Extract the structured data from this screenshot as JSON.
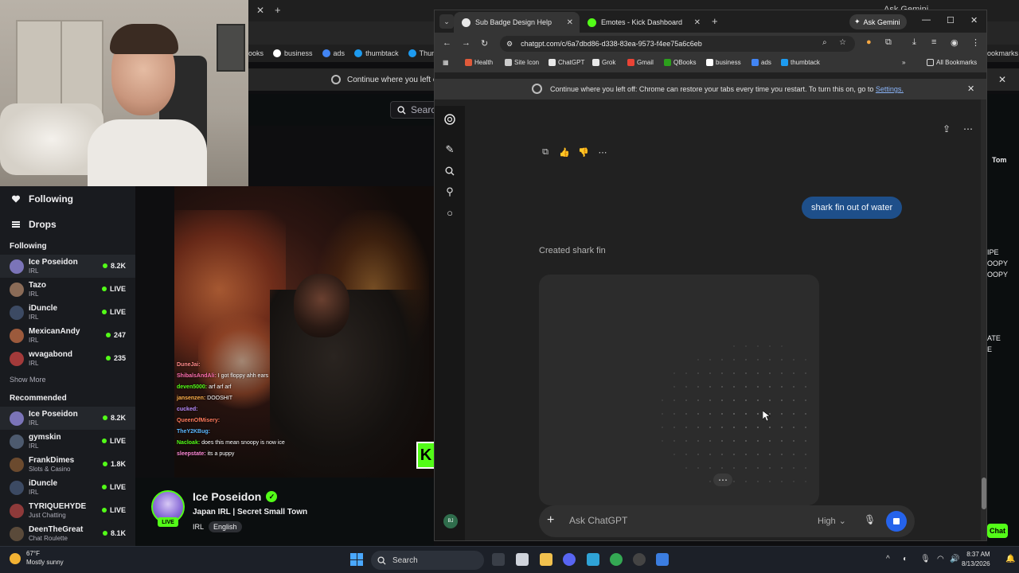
{
  "background_browser": {
    "bookmarks": [
      {
        "label": "ooks",
        "color": "#7a7a7a"
      },
      {
        "label": "business",
        "color": "#ffffff"
      },
      {
        "label": "ads",
        "color": "#4285f4"
      },
      {
        "label": "thumbtack",
        "color": "#1d9bf0"
      },
      {
        "label": "Thumbta",
        "color": "#1d9bf0"
      }
    ],
    "bookmarks_right": "ookmarks",
    "infobar_text": "Continue where you left off:",
    "gemini_label": "Ask Gemini",
    "search_label": "Searc"
  },
  "kick": {
    "sidebar": {
      "nav": [
        {
          "label": "Following",
          "icon": "heart-icon"
        },
        {
          "label": "Drops",
          "icon": "drops-icon"
        }
      ],
      "following_heading": "Following",
      "following": [
        {
          "name": "Ice Poseidon",
          "category": "IRL",
          "stat": "8.2K",
          "avatar": "#7b74b8",
          "active": true
        },
        {
          "name": "Tazo",
          "category": "IRL",
          "stat": "LIVE",
          "avatar": "#8a6b57"
        },
        {
          "name": "iDuncle",
          "category": "IRL",
          "stat": "LIVE",
          "avatar": "#3c4a63"
        },
        {
          "name": "MexicanAndy",
          "category": "IRL",
          "stat": "247",
          "avatar": "#9c5a3c"
        },
        {
          "name": "wvagabond",
          "category": "IRL",
          "stat": "235",
          "avatar": "#a33a3a"
        }
      ],
      "show_more": "Show More",
      "recommended_heading": "Recommended",
      "recommended": [
        {
          "name": "Ice Poseidon",
          "category": "IRL",
          "stat": "8.2K",
          "avatar": "#7b74b8",
          "active": true
        },
        {
          "name": "gymskin",
          "category": "IRL",
          "stat": "LIVE",
          "avatar": "#4d5a6e"
        },
        {
          "name": "FrankDimes",
          "category": "Slots & Casino",
          "stat": "1.8K",
          "avatar": "#6b4a2e"
        },
        {
          "name": "iDuncle",
          "category": "IRL",
          "stat": "LIVE",
          "avatar": "#3c4a63"
        },
        {
          "name": "TYRIQUEHYDE",
          "category": "Just Chatting",
          "stat": "LIVE",
          "avatar": "#8e3a3a"
        },
        {
          "name": "DeenTheGreat",
          "category": "Chat Roulette",
          "stat": "8.1K",
          "avatar": "#5a4a3a"
        }
      ]
    },
    "chat": [
      {
        "user": "DuneJai:",
        "text": "",
        "color": "#ff8a8a"
      },
      {
        "user": "ShibalsAndAli:",
        "text": "I got floppy ahh ears",
        "color": "#ff6fb0"
      },
      {
        "user": "deven5000:",
        "text": "arf arf arf",
        "color": "#53fc18"
      },
      {
        "user": "jansenzen:",
        "text": "DOOSHIT",
        "color": "#ffb14a"
      },
      {
        "user": "cucked:",
        "text": "",
        "color": "#b88cff"
      },
      {
        "user": "QueenOfMisery:",
        "text": "",
        "color": "#ff7a5c"
      },
      {
        "user": "TheY2KBug:",
        "text": "",
        "color": "#5cb8ff"
      },
      {
        "user": "Nacloak:",
        "text": "does this mean snoopy is now ice",
        "color": "#53fc18"
      },
      {
        "user": "sleepstate:",
        "text": "its a puppy",
        "color": "#ff8ad8"
      }
    ],
    "streamer": {
      "name": "Ice Poseidon",
      "live": "LIVE",
      "title": "Japan IRL | Secret Small Town",
      "category": "IRL",
      "language": "English"
    },
    "right_panel": {
      "tom": "Tom",
      "lines": [
        "IPE",
        "OOPY",
        "OOPY",
        "ATE",
        "E"
      ],
      "chat_btn": "Chat"
    }
  },
  "chrome": {
    "tabs": [
      {
        "label": "Sub Badge Design Help",
        "favicon": "#e8e8e8",
        "active": true
      },
      {
        "label": "Emotes - Kick Dashboard",
        "favicon": "#53fc18",
        "active": false
      }
    ],
    "gemini_label": "Ask Gemini",
    "url": "chatgpt.com/c/6a7dbd86-d338-83ea-9573-f4ee75a6c6eb",
    "bookmarks": [
      {
        "label": "Health",
        "color": "#e05a3a"
      },
      {
        "label": "Site Icon",
        "color": "#cccccc"
      },
      {
        "label": "ChatGPT",
        "color": "#e8e8e8"
      },
      {
        "label": "Grok",
        "color": "#e8e8e8"
      },
      {
        "label": "Gmail",
        "color": "#ea4335"
      },
      {
        "label": "QBooks",
        "color": "#2ca01c"
      },
      {
        "label": "business",
        "color": "#ffffff"
      },
      {
        "label": "ads",
        "color": "#4285f4"
      },
      {
        "label": "thumbtack",
        "color": "#1d9bf0"
      }
    ],
    "all_bookmarks": "All Bookmarks",
    "infobar": {
      "text": "Continue where you left off: Chrome can restore your tabs every time you restart. To turn this on, go to",
      "link": "Settings."
    }
  },
  "chatgpt": {
    "user_message": "shark fin out of water",
    "status": "Created shark fin",
    "composer_placeholder": "Ask ChatGPT",
    "model_label": "High",
    "avatar_initials": "BJ"
  },
  "taskbar": {
    "weather_temp": "67°F",
    "weather_desc": "Mostly sunny",
    "search_label": "Search",
    "time": "8:37 AM",
    "date": "8/13/2026"
  }
}
